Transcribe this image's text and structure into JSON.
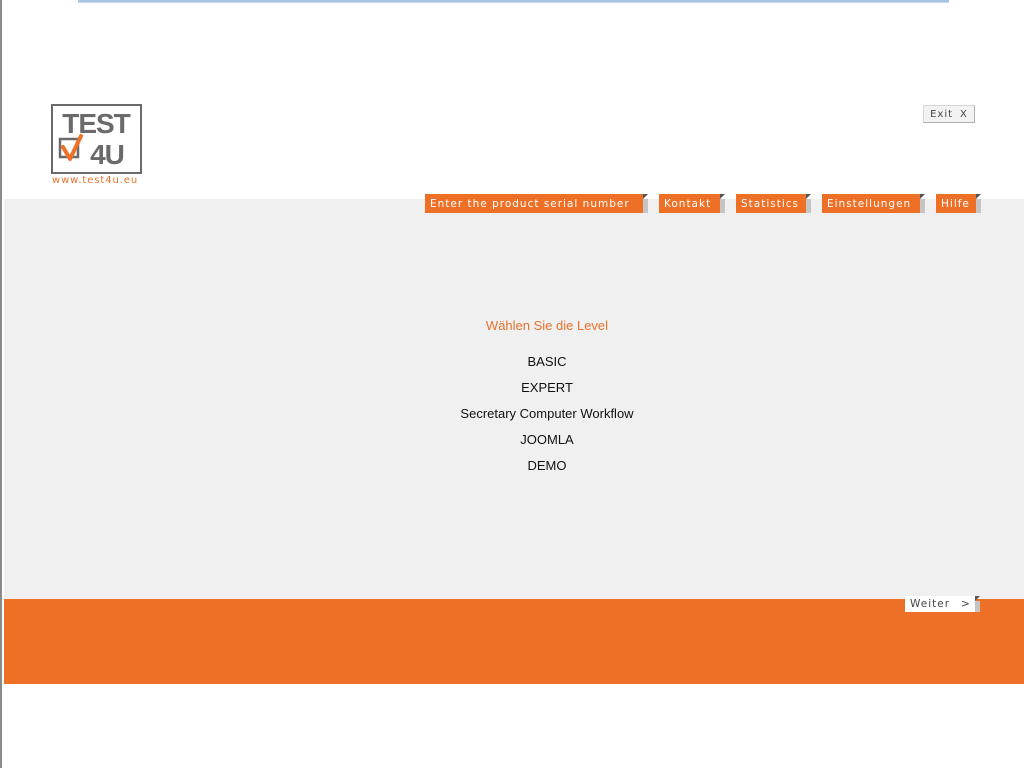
{
  "logo": {
    "text_line1": "TEST",
    "text_line2": "4U",
    "url": "www.test4u.eu"
  },
  "exit_button": {
    "label": "Exit",
    "icon": "close-icon",
    "glyph": "X"
  },
  "nav": {
    "items": [
      {
        "label": "Enter the product serial number"
      },
      {
        "label": "Kontakt"
      },
      {
        "label": "Statistics"
      },
      {
        "label": "Einstellungen"
      },
      {
        "label": "Hilfe"
      }
    ]
  },
  "main": {
    "title": "Wählen Sie die Level",
    "levels": [
      {
        "label": "BASIC"
      },
      {
        "label": "EXPERT"
      },
      {
        "label": "Secretary Computer Workflow"
      },
      {
        "label": "JOOMLA"
      },
      {
        "label": "DEMO"
      }
    ]
  },
  "footer": {
    "next_button": {
      "label": "Weiter",
      "glyph": ">"
    }
  },
  "colors": {
    "accent": "#ee7027",
    "content_background": "#f0f0f0",
    "logo_gray": "#6a6a6a"
  }
}
